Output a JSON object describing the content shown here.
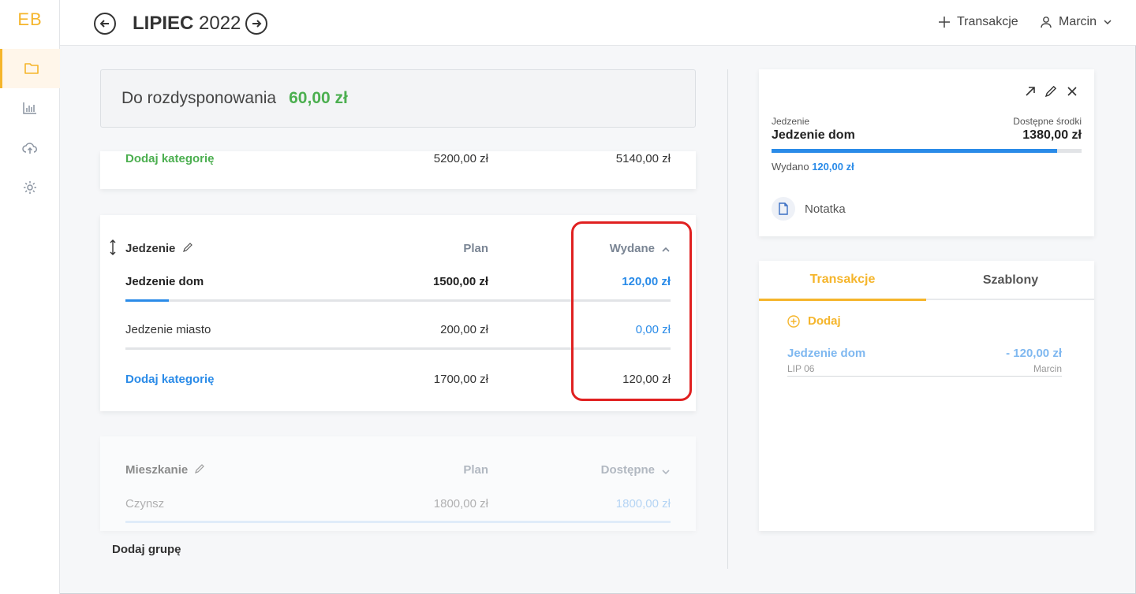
{
  "sidebar": {
    "logo": "EB",
    "items": [
      {
        "icon": "folder-icon",
        "active": true
      },
      {
        "icon": "bar-chart-icon",
        "active": false
      },
      {
        "icon": "cloud-upload-icon",
        "active": false
      },
      {
        "icon": "gear-icon",
        "active": false
      }
    ]
  },
  "header": {
    "month_bold": "LIPIEC",
    "year": "2022",
    "add_transaction": "Transakcje",
    "user": "Marcin"
  },
  "summary": {
    "label": "Do rozdysponowania",
    "amount": "60,00 zł"
  },
  "group_income": {
    "add_category": "Dodaj kategorię",
    "plan_total": "5200,00 zł",
    "value_total": "5140,00 zł"
  },
  "group_food": {
    "title": "Jedzenie",
    "col_plan": "Plan",
    "col_value": "Wydane",
    "rows": [
      {
        "name": "Jedzenie dom",
        "plan": "1500,00 zł",
        "value": "120,00 zł",
        "progress": 0.08
      },
      {
        "name": "Jedzenie miasto",
        "plan": "200,00 zł",
        "value": "0,00 zł",
        "progress": 0
      }
    ],
    "add_category": "Dodaj kategorię",
    "plan_total": "1700,00 zł",
    "value_total": "120,00 zł"
  },
  "group_home": {
    "title": "Mieszkanie",
    "col_plan": "Plan",
    "col_value": "Dostępne",
    "rows": [
      {
        "name": "Czynsz",
        "plan": "1800,00 zł",
        "value": "1800,00 zł"
      }
    ]
  },
  "add_group": "Dodaj grupę",
  "detail": {
    "group_label": "Jedzenie",
    "category": "Jedzenie dom",
    "available_label": "Dostępne środki",
    "available": "1380,00 zł",
    "progress": 0.92,
    "spent_label": "Wydano",
    "spent": "120,00 zł",
    "note": "Notatka"
  },
  "transactions_panel": {
    "tab_active": "Transakcje",
    "tab_inactive": "Szablony",
    "add": "Dodaj",
    "items": [
      {
        "name": "Jedzenie dom",
        "amount": "- 120,00 zł",
        "date": "LIP 06",
        "user": "Marcin"
      }
    ]
  },
  "colors": {
    "accent": "#f5b52b",
    "green": "#4caf50",
    "blue": "#2a8be8",
    "highlight": "#e02020"
  }
}
